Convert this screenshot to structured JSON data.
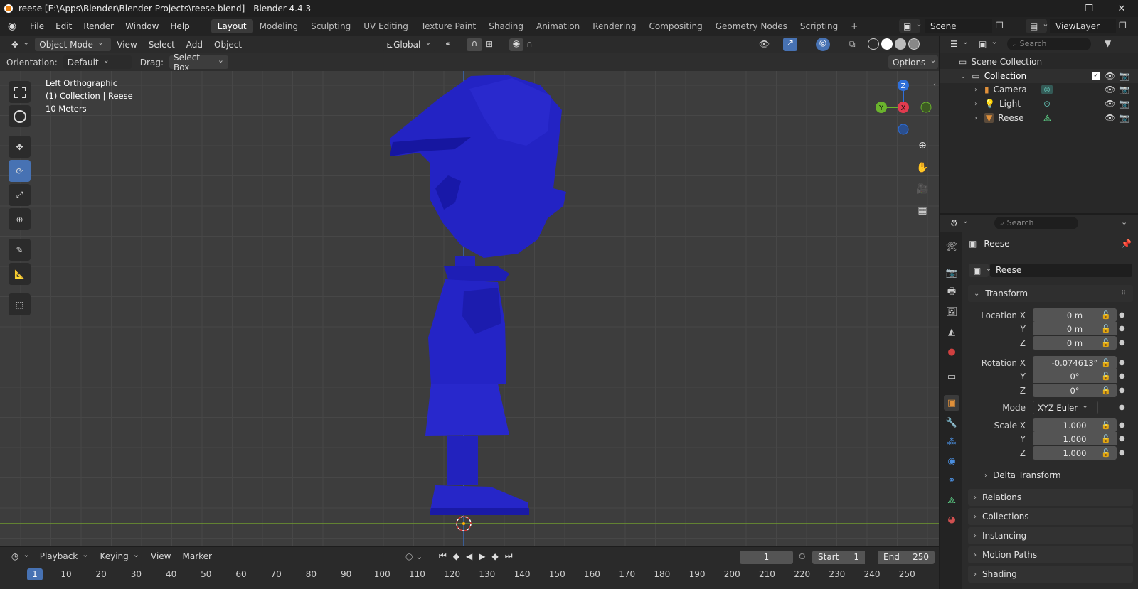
{
  "title": {
    "text": "reese [E:\\Apps\\Blender\\Blender Projects\\reese.blend] - Blender 4.4.3"
  },
  "menu": [
    "File",
    "Edit",
    "Render",
    "Window",
    "Help"
  ],
  "workspaces": [
    "Layout",
    "Modeling",
    "Sculpting",
    "UV Editing",
    "Texture Paint",
    "Shading",
    "Animation",
    "Rendering",
    "Compositing",
    "Geometry Nodes",
    "Scripting"
  ],
  "active_workspace": "Layout",
  "scene": {
    "name": "Scene",
    "view_layer": "ViewLayer"
  },
  "viewport": {
    "mode": "Object Mode",
    "view": "View",
    "select": "Select",
    "add": "Add",
    "object": "Object",
    "transform_orientation": "Global",
    "orientation_label": "Orientation:",
    "orientation_value": "Default",
    "drag_label": "Drag:",
    "drag_value": "Select Box",
    "options": "Options",
    "overlay_line1": "Left Orthographic",
    "overlay_line2": "(1) Collection | Reese",
    "overlay_line3": "10 Meters",
    "gizmo": {
      "z": "Z",
      "y": "Y",
      "x": "X"
    },
    "mesh_color": "#2020c0"
  },
  "timeline": {
    "playback": "Playback",
    "keying": "Keying",
    "view": "View",
    "marker": "Marker",
    "current_frame": "1",
    "start_label": "Start",
    "start": "1",
    "end_label": "End",
    "end": "250",
    "ticks": [
      "1",
      "10",
      "20",
      "30",
      "40",
      "50",
      "60",
      "70",
      "80",
      "90",
      "100",
      "110",
      "120",
      "130",
      "140",
      "150",
      "160",
      "170",
      "180",
      "190",
      "200",
      "210",
      "220",
      "230",
      "240",
      "250"
    ]
  },
  "outliner": {
    "search_placeholder": "Search",
    "scene_collection": "Scene Collection",
    "collection": "Collection",
    "items": [
      "Camera",
      "Light",
      "Reese"
    ]
  },
  "properties": {
    "search_placeholder": "Search",
    "object_name": "Reese",
    "datablock_name": "Reese",
    "transform": "Transform",
    "location_label": "Location X",
    "loc_x": "0 m",
    "loc_y": "0 m",
    "loc_z": "0 m",
    "rotation_label": "Rotation X",
    "rot_x": "-0.074613°",
    "rot_y": "0°",
    "rot_z": "0°",
    "mode_label": "Mode",
    "mode": "XYZ Euler",
    "scale_label": "Scale X",
    "scale_x": "1.000",
    "scale_y": "1.000",
    "scale_z": "1.000",
    "y": "Y",
    "z": "Z",
    "delta": "Delta Transform",
    "panels": [
      "Relations",
      "Collections",
      "Instancing",
      "Motion Paths",
      "Shading"
    ]
  }
}
